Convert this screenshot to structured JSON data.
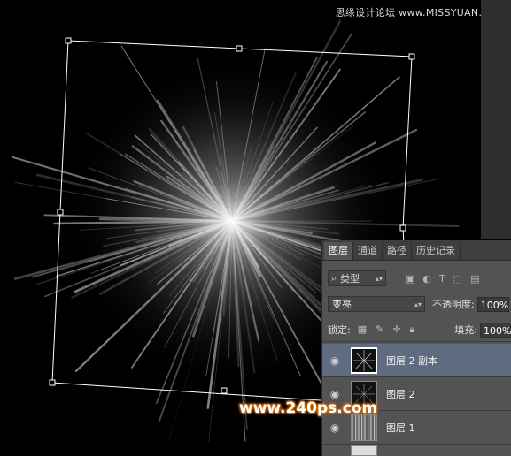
{
  "watermark_top": "思缘设计论坛 www.MISSYUAN.COM",
  "watermark_bottom": "www.240ps.com",
  "layers_panel": {
    "tabs": [
      {
        "label": "图层",
        "active": true
      },
      {
        "label": "通道",
        "active": false
      },
      {
        "label": "路径",
        "active": false
      },
      {
        "label": "历史记录",
        "active": false
      }
    ],
    "filter": {
      "kind_label": "类型",
      "icon": "search-icon"
    },
    "blend_mode": "变亮",
    "opacity_label": "不透明度:",
    "opacity_value": "100%",
    "lock_label": "锁定:",
    "fill_label": "填充:",
    "fill_value": "100%",
    "layers": [
      {
        "name": "图层 2 副本",
        "selected": true,
        "visible": true
      },
      {
        "name": "图层 2",
        "selected": false,
        "visible": true
      },
      {
        "name": "图层 1",
        "selected": false,
        "visible": true
      }
    ]
  },
  "colors": {
    "background": "#000000",
    "panel": "#535353",
    "selected_layer": "#5f6b80",
    "watermark_glow": "#e07a10"
  }
}
